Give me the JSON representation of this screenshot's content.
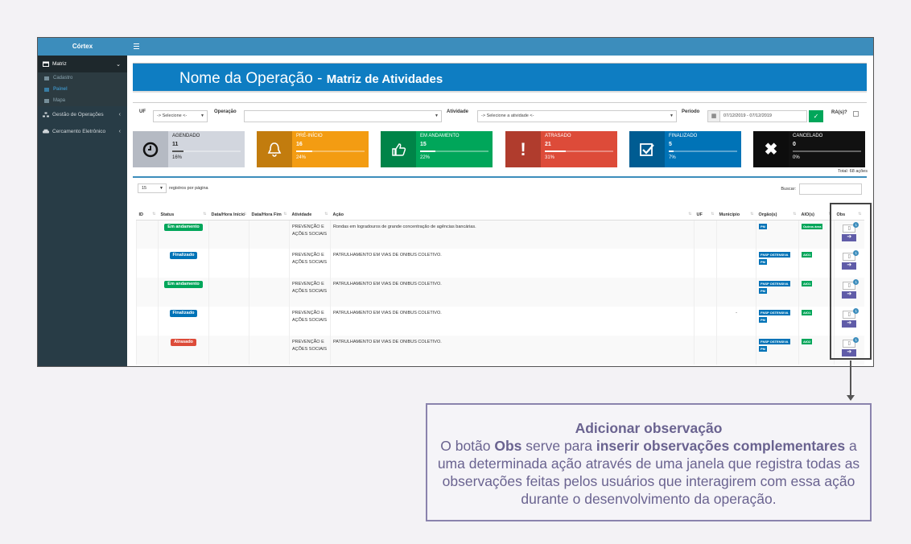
{
  "sidebar": {
    "brand": "Córtex",
    "items": [
      {
        "label": "Matriz",
        "icon": "calendar-icon"
      },
      {
        "label": "Gestão de Operações",
        "icon": "network-icon"
      },
      {
        "label": "Cercamento Eletrônico",
        "icon": "car-icon"
      }
    ],
    "subitems": [
      {
        "label": "Cadastro",
        "icon": "edit-icon"
      },
      {
        "label": "Painel",
        "icon": "list-icon"
      },
      {
        "label": "Mapa",
        "icon": "map-icon"
      }
    ]
  },
  "header": {
    "title_main": "Nome da Operação - ",
    "title_bold": "Matriz de Atividades"
  },
  "filters": {
    "uf_label": "UF",
    "uf_value": "-> Selecione <-",
    "operacao_label": "Operação",
    "operacao_value": "",
    "atividade_label": "Atividade",
    "atividade_value": "-> Selecione a atividade <-",
    "periodo_label": "Período",
    "periodo_value": "07/12/2019 - 07/12/2019",
    "ra_label": "RA(s)?"
  },
  "cards": [
    {
      "label": "AGENDADO",
      "value": "11",
      "percent": "16%",
      "fill": 16,
      "color": "#d2d6de",
      "text_color": "#222",
      "icon": "clock-icon"
    },
    {
      "label": "PRÉ-INÍCIO",
      "value": "16",
      "percent": "24%",
      "fill": 24,
      "color": "#f39c12",
      "text_color": "#fff",
      "icon": "bell-icon"
    },
    {
      "label": "EM ANDAMENTO",
      "value": "15",
      "percent": "22%",
      "fill": 22,
      "color": "#00a65a",
      "text_color": "#fff",
      "icon": "thumbs-up-icon"
    },
    {
      "label": "ATRASADO",
      "value": "21",
      "percent": "31%",
      "fill": 31,
      "color": "#dd4b39",
      "text_color": "#fff",
      "icon": "exclamation-icon"
    },
    {
      "label": "FINALIZADO",
      "value": "5",
      "percent": "7%",
      "fill": 7,
      "color": "#0073b7",
      "text_color": "#fff",
      "icon": "check-icon"
    },
    {
      "label": "CANCELADO",
      "value": "0",
      "percent": "0%",
      "fill": 0,
      "color": "#111111",
      "text_color": "#fff",
      "icon": "x-icon"
    }
  ],
  "total": "Total: 68 ações",
  "table": {
    "per_page_value": "15",
    "per_page_label": "registros por página",
    "search_label": "Buscar:",
    "columns": [
      "ID",
      "Status",
      "Data/Hora Início",
      "Data/Hora Fim",
      "Atividade",
      "Ação",
      "UF",
      "Município",
      "Orgão(s)",
      "AIO(s)",
      "Obs"
    ],
    "rows": [
      {
        "status": "Em andamento",
        "status_color": "green",
        "atividade": "PREVENÇÃO E AÇÕES SOCIAIS",
        "acao": "Rondas em logradouros de grande concentração de agências bancárias.",
        "municipio": "",
        "orgaos": [
          "PM"
        ],
        "aio": "Outros área",
        "obs_count": "1"
      },
      {
        "status": "Finalizado",
        "status_color": "blue",
        "atividade": "PREVENÇÃO E AÇÕES SOCIAIS",
        "acao": "PATRULHAMENTO EM VIAS DE ONIBUS COLETIVO.",
        "municipio": "",
        "orgaos": [
          "FNSP OSTENSIVA",
          "PM"
        ],
        "aio": "AIO1",
        "obs_count": "1"
      },
      {
        "status": "Em andamento",
        "status_color": "green",
        "atividade": "PREVENÇÃO E AÇÕES SOCIAIS",
        "acao": "PATRULHAMENTO EM VIAS DE ONIBUS COLETIVO.",
        "municipio": "",
        "orgaos": [
          "FNSP OSTENSIVA",
          "PM"
        ],
        "aio": "AIO1",
        "obs_count": "1"
      },
      {
        "status": "Finalizado",
        "status_color": "blue",
        "atividade": "PREVENÇÃO E AÇÕES SOCIAIS",
        "acao": "PATRULHAMENTO EM VIAS DE ONIBUS COLETIVO.",
        "municipio": "-",
        "orgaos": [
          "FNSP OSTENSIVA",
          "PM"
        ],
        "aio": "AIO1",
        "obs_count": "1"
      },
      {
        "status": "Atrasado",
        "status_color": "red",
        "atividade": "PREVENÇÃO E AÇÕES SOCIAIS",
        "acao": "PATRULHAMENTO EM VIAS DE ONIBUS COLETIVO.",
        "municipio": "",
        "orgaos": [
          "FNSP OSTENSIVA",
          "PM"
        ],
        "aio": "AIO2",
        "obs_count": "1"
      }
    ]
  },
  "callout": {
    "heading": "Adicionar observação",
    "p1": "O botão ",
    "b1": "Obs",
    "p2": " serve para ",
    "b2": "inserir observações complementares",
    "p3": " a uma determinada ação através de uma janela que registra todas as observações feitas pelos usuários que interagirem com essa ação durante o desenvolvimento da operação."
  }
}
